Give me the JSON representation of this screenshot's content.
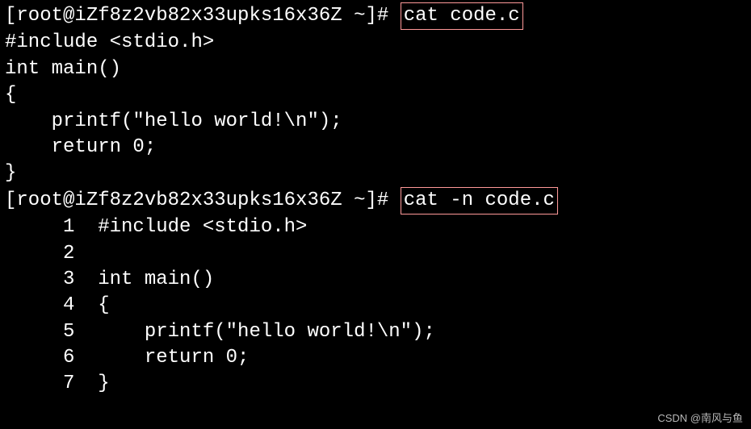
{
  "prompt1": {
    "prefix": "[root@iZf8z2vb82x33upks16x36Z ~]# ",
    "command": "cat code.c"
  },
  "output1": {
    "lines": [
      "#include <stdio.h>",
      "",
      "int main()",
      "{",
      "    printf(\"hello world!\\n\");",
      "    return 0;",
      "}"
    ]
  },
  "prompt2": {
    "prefix": "[root@iZf8z2vb82x33upks16x36Z ~]# ",
    "command": "cat -n code.c"
  },
  "output2": {
    "numbered_lines": [
      {
        "n": "1",
        "text": "#include <stdio.h>"
      },
      {
        "n": "2",
        "text": ""
      },
      {
        "n": "3",
        "text": "int main()"
      },
      {
        "n": "4",
        "text": "{"
      },
      {
        "n": "5",
        "text": "    printf(\"hello world!\\n\");"
      },
      {
        "n": "6",
        "text": "    return 0;"
      },
      {
        "n": "7",
        "text": "}"
      }
    ]
  },
  "watermark": "CSDN @南风与鱼"
}
